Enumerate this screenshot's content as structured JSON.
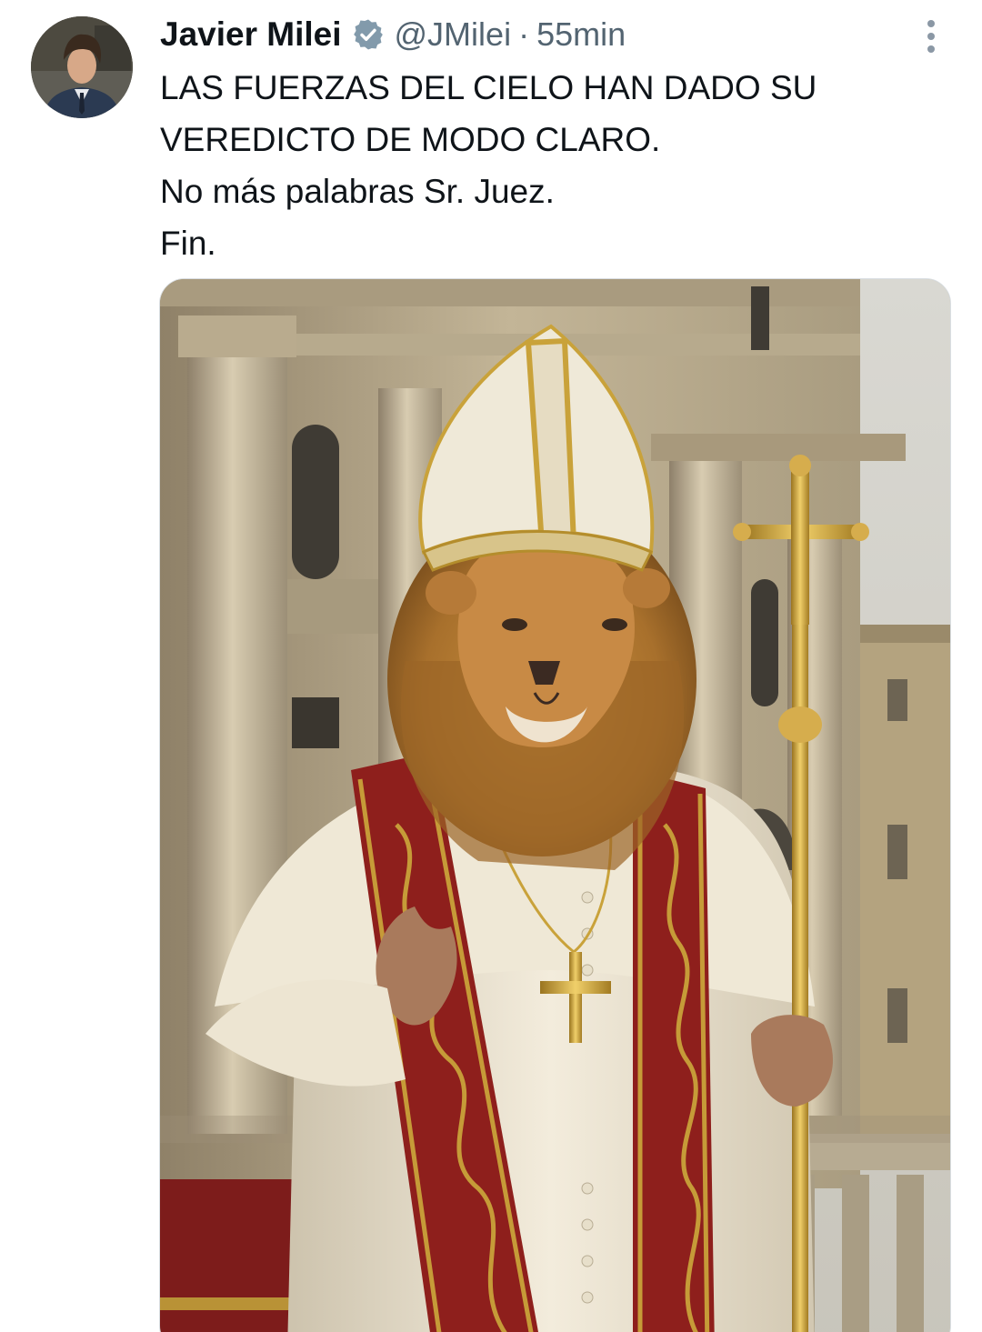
{
  "tweet": {
    "author": {
      "name": "Javier Milei",
      "handle": "@JMilei",
      "verified": true,
      "avatar_icon": "avatar-photo"
    },
    "separator": "·",
    "time": "55min",
    "text_lines": [
      "LAS FUERZAS DEL CIELO HAN DADO SU",
      "VEREDICTO DE MODO CLARO.",
      "No más palabras Sr. Juez.",
      "Fin."
    ],
    "media": {
      "kind": "photo",
      "description_icon": "lion-pope-image"
    }
  },
  "colors": {
    "text": "#0f1419",
    "secondary": "#536471",
    "verified_badge": "#829aab",
    "stole_red": "#8e1f1c",
    "gold": "#c9a23a",
    "vestment_white": "#eee7d6"
  },
  "icons": {
    "verified": "verified-badge-icon",
    "more": "more-options-icon"
  }
}
